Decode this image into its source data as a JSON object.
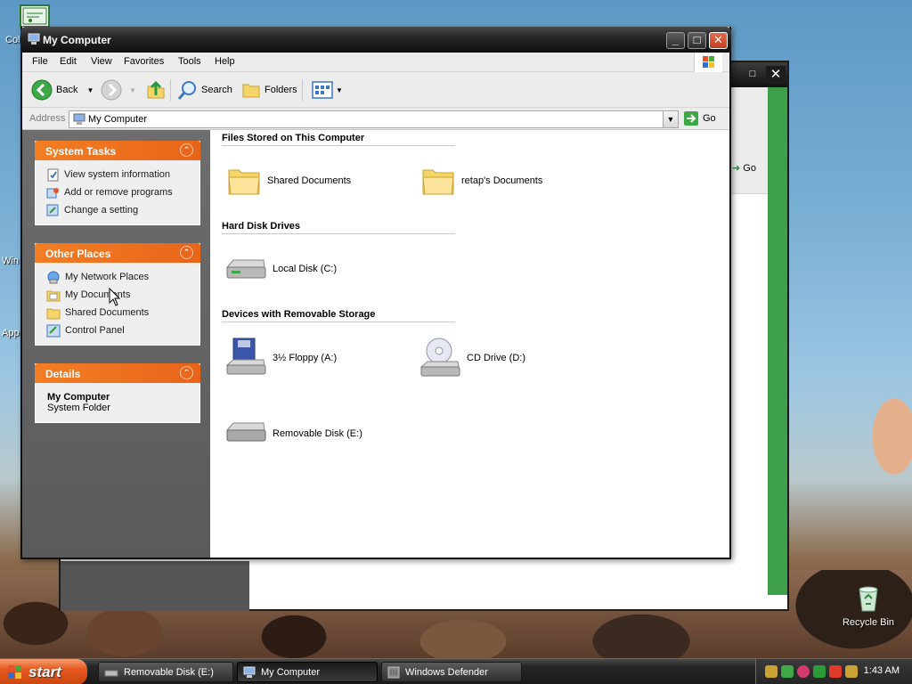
{
  "window": {
    "title": "My Computer",
    "menu": [
      "File",
      "Edit",
      "View",
      "Favorites",
      "Tools",
      "Help"
    ],
    "toolbar": {
      "back": "Back",
      "search": "Search",
      "folders": "Folders"
    },
    "address": {
      "label": "Address",
      "value": "My Computer",
      "go": "Go"
    }
  },
  "left_pane": {
    "system_tasks": {
      "title": "System Tasks",
      "items": [
        "View system information",
        "Add or remove programs",
        "Change a setting"
      ]
    },
    "other_places": {
      "title": "Other Places",
      "items": [
        "My Network Places",
        "My Documents",
        "Shared Documents",
        "Control Panel"
      ]
    },
    "details": {
      "title": "Details",
      "name": "My Computer",
      "type": "System Folder"
    }
  },
  "right_pane": {
    "groups": {
      "files": "Files Stored on This Computer",
      "hdd": "Hard Disk Drives",
      "removable": "Devices with Removable Storage"
    },
    "items": {
      "shared_docs": "Shared Documents",
      "user_docs": "retap's Documents",
      "local_disk": "Local Disk (C:)",
      "floppy": "3½ Floppy (A:)",
      "cd": "CD Drive (D:)",
      "removable_disk": "Removable Disk (E:)"
    }
  },
  "background_window": {
    "go": "Go"
  },
  "desktop": {
    "recycle_bin": "Recycle Bin",
    "cut_labels": [
      "Col",
      "Win",
      "App"
    ]
  },
  "taskbar": {
    "start": "start",
    "tasks": [
      "Removable Disk (E:)",
      "My Computer",
      "Windows Defender"
    ],
    "clock": "1:43 AM"
  },
  "colors": {
    "panel_header": "#f37e24",
    "titlebar": "#1a1a1a",
    "start_button": "#e5571f"
  }
}
